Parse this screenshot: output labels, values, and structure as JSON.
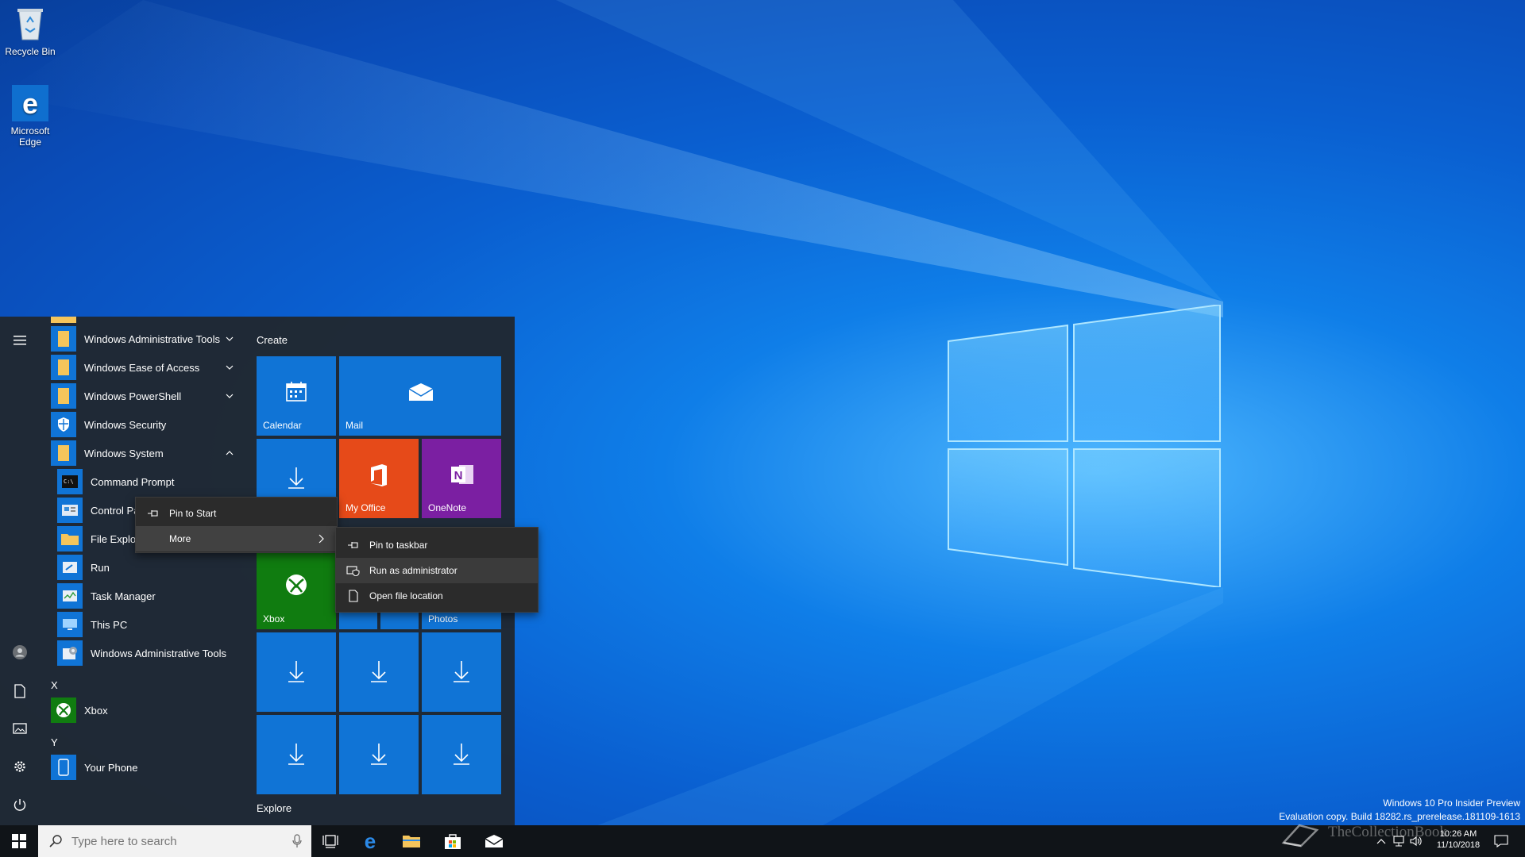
{
  "desktop": {
    "icons": [
      {
        "label": "Recycle Bin",
        "icon": "recycle-bin-icon"
      },
      {
        "label": "Microsoft Edge",
        "icon": "edge-icon"
      }
    ]
  },
  "start_menu": {
    "rail": [
      "hamburger-icon",
      "user-icon",
      "documents-icon",
      "pictures-icon",
      "settings-icon",
      "power-icon"
    ],
    "apps": [
      {
        "label": "Windows Administrative Tools",
        "icon": "folder-icon",
        "expand": "down"
      },
      {
        "label": "Windows Ease of Access",
        "icon": "folder-icon",
        "expand": "down"
      },
      {
        "label": "Windows PowerShell",
        "icon": "folder-icon",
        "expand": "down"
      },
      {
        "label": "Windows Security",
        "icon": "shield-icon"
      },
      {
        "label": "Windows System",
        "icon": "folder-icon",
        "expand": "up"
      },
      {
        "label": "Command Prompt",
        "icon": "cmd-icon"
      },
      {
        "label": "Control Pa",
        "icon": "control-panel-icon"
      },
      {
        "label": "File Explore",
        "icon": "file-explorer-icon"
      },
      {
        "label": "Run",
        "icon": "run-icon"
      },
      {
        "label": "Task Manager",
        "icon": "task-manager-icon"
      },
      {
        "label": "This PC",
        "icon": "this-pc-icon"
      },
      {
        "label": "Windows Administrative Tools",
        "icon": "admin-tools-icon"
      }
    ],
    "letters": [
      "X",
      "Y"
    ],
    "apps_x": [
      {
        "label": "Xbox",
        "icon": "xbox-icon"
      }
    ],
    "apps_y": [
      {
        "label": "Your Phone",
        "icon": "phone-icon"
      }
    ],
    "groups": {
      "create": "Create",
      "explore": "Explore"
    },
    "tiles": {
      "calendar": "Calendar",
      "mail": "Mail",
      "my_office": "My Office",
      "onenote": "OneNote",
      "xbox": "Xbox",
      "photos": "Photos"
    }
  },
  "context_menu": {
    "items": [
      {
        "label": "Pin to Start",
        "icon": "pin-icon"
      },
      {
        "label": "More",
        "icon": "chevron-right-icon"
      }
    ]
  },
  "submenu": {
    "items": [
      {
        "label": "Pin to taskbar",
        "icon": "pin-icon"
      },
      {
        "label": "Run as administrator",
        "icon": "admin-shield-icon"
      },
      {
        "label": "Open file location",
        "icon": "file-location-icon"
      }
    ]
  },
  "taskbar": {
    "search_placeholder": "Type here to search",
    "clock_time": "10:26 AM",
    "clock_date": "11/10/2018"
  },
  "watermark": {
    "line1": "Windows 10 Pro Insider Preview",
    "line2": "Evaluation copy. Build 18282.rs_prerelease.181109-1613"
  },
  "brand": "TheCollectionBook",
  "colors": {
    "tile_blue": "#1074d6",
    "office_orange": "#e64a19",
    "onenote_purple": "#7b1fa2",
    "xbox_green": "#107c10",
    "folder_yellow": "#f5c55b"
  }
}
